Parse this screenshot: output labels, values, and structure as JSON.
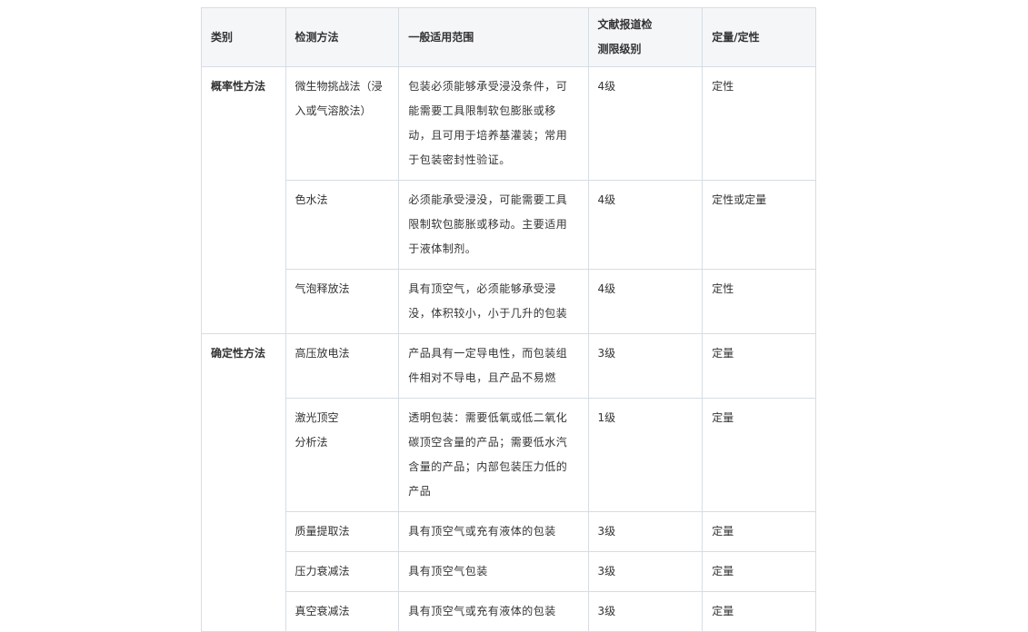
{
  "table": {
    "headers": {
      "category": "类别",
      "method": "检测方法",
      "scope": "一般适用范围",
      "detection_line1": "文献报道检",
      "detection_line2": "测限级别",
      "quant": "定量/定性"
    },
    "groups": [
      {
        "category": "概率性方法",
        "rows": [
          {
            "method": [
              "微生物挑战法（浸",
              "入或气溶胶法）"
            ],
            "scope": [
              "包装必须能够承受浸没条件，可",
              "能需要工具限制软包膨胀或移",
              "动，且可用于培养基灌装；常用",
              "于包装密封性验证。"
            ],
            "level": "4级",
            "quant": "定性"
          },
          {
            "method": [
              "色水法"
            ],
            "scope": [
              "必须能承受浸没，可能需要工具",
              "限制软包膨胀或移动。主要适用",
              "于液体制剂。"
            ],
            "level": "4级",
            "quant": "定性或定量"
          },
          {
            "method": [
              "气泡释放法"
            ],
            "scope": [
              "具有顶空气，必须能够承受浸",
              "没，体积较小，小于几升的包装"
            ],
            "level": "4级",
            "quant": "定性"
          }
        ]
      },
      {
        "category": "确定性方法",
        "rows": [
          {
            "method": [
              "高压放电法"
            ],
            "scope": [
              "产品具有一定导电性，而包装组",
              "件相对不导电，且产品不易燃"
            ],
            "level": "3级",
            "quant": "定量"
          },
          {
            "method": [
              "激光顶空",
              "分析法"
            ],
            "scope": [
              "透明包装：需要低氧或低二氧化",
              "碳顶空含量的产品；需要低水汽",
              "含量的产品；内部包装压力低的",
              "产品"
            ],
            "level": "1级",
            "quant": "定量"
          },
          {
            "method": [
              "质量提取法"
            ],
            "scope": [
              "具有顶空气或充有液体的包装"
            ],
            "level": "3级",
            "quant": "定量"
          },
          {
            "method": [
              "压力衰减法"
            ],
            "scope": [
              "具有顶空气包装"
            ],
            "level": "3级",
            "quant": "定量"
          },
          {
            "method": [
              "真空衰减法"
            ],
            "scope": [
              "具有顶空气或充有液体的包装"
            ],
            "level": "3级",
            "quant": "定量"
          }
        ]
      }
    ]
  }
}
